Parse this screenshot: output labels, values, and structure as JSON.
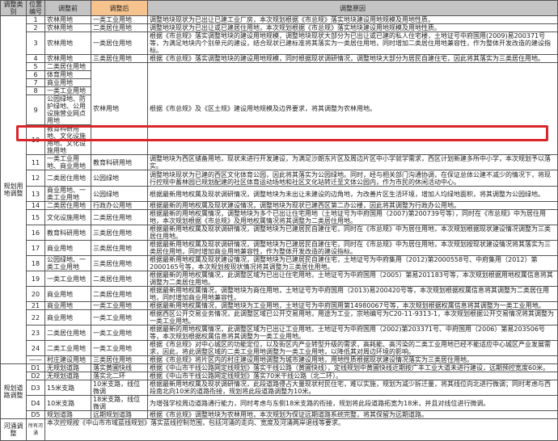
{
  "header": {
    "category": "调整类别",
    "no": "位置编号",
    "before": "调整前",
    "after": "调整后",
    "reason": "调整原因"
  },
  "categories": [
    "规划用地调整",
    "规划道路调整",
    "河涌调整"
  ],
  "rows": [
    {
      "no": "1",
      "before": "农林用地",
      "after": "一类工业用地",
      "reason": "调整地块现状为已出让已建工业厂房，本次规划根据《市总规》落实地块建设用地规模及用地性质。"
    },
    {
      "no": "2",
      "before": "农林用地",
      "after": "二类居住用地",
      "reason": "调整地块现状为已出让或已建居住用地，本次规划根据《市总规》落实地块建设用地规模及用地性质。"
    },
    {
      "no": "3",
      "before": "农林用地",
      "after": "一类居住用地",
      "reason": "根据《市总规》落实调整地块的建设用地规模，调整地块现状大部分为已出让或已建的私人住宅楼，土地证号中府国用(2009)易200371号等，为满足地块内个别单元的建设，结合现状已建标准将其落实为一类居住用地，同时增加二类居住用地兼容性，作为整体开发改造的建设指标。"
    },
    {
      "no": "4",
      "before": "农林用地",
      "after": "三类居住用地",
      "reason": "根据《市总规》落实调整地块的建设用地规模，同时根据现状调研情况，调整地块大部分为居民自建住宅，因此将其落实为三类居住用地。"
    },
    {
      "no": "5",
      "before": "二类居住用地",
      "after": "农林用地",
      "reason": "根据《市总规》及《区土规》建设用地规模及边界要求，将其调整为农林用地。"
    },
    {
      "no": "6",
      "before": "体育用地"
    },
    {
      "no": "7",
      "before": "商业用地"
    },
    {
      "no": "8",
      "before": "一类工业用地"
    },
    {
      "no": "9",
      "before": "公园绿地、防护绿地、公用设施营业网点用地"
    },
    {
      "no": "10",
      "before": "教育科研用地、文化设施用地、文化设施用地"
    },
    {
      "no": "11",
      "before": "一类工业用地、商业用地",
      "after": "教育科研用地",
      "reason": "调整地块为西区储备用地，现状未进行开发建设，为满足沙朗东片区及周边片区中小学就学需求，西区计划新建多所中小学，本次规划予以落实。"
    },
    {
      "no": "12",
      "before": "二类居住用地",
      "after": "公园绿地",
      "reason": "调整地块现状为已建的西区文化体育公园，因此将其落实为公园绿地。同时，经与相关部门沟通协调，在保证总体公建不减少的情况下，将现行控规中蓄林园已规划配建的社区体育运动场地和社区文化站转迁至文体公园内，作为市民的休闲活动中心。"
    },
    {
      "no": "13",
      "before": "商业用地、一类工业用地",
      "after": "公园绿地",
      "reason": "根据最新用地权属及现状调研情况，调整地块为未出让未建设的边角地，为改善片区生活环境，增加人均绿地面积，将其调整为公园绿地。"
    },
    {
      "no": "14",
      "before": "二类居住用地",
      "after": "行政办公用地",
      "reason": "根据最新的用地权属及现状建设情况，调整地块为现状已建西区第二办公楼，因此将其调整为行政办公用地。"
    },
    {
      "no": "15",
      "before": "文化设施用地",
      "after": "二类居住用地",
      "reason": "根据最新的用地权属情况，调整地块为多个已出让住宅用地（土地证号为中府国用（2007)第200739号等），同时在《市总规》中为居住用地，本次规划根据《市总规》及用地权属情况将其调整为二类居住用地。"
    },
    {
      "no": "16",
      "before": "教育科研用地",
      "after": "三类居住用地",
      "reason": "根据最新用地权属及现状调研情况，调整地块为已建居民自建住宅，同时在《市总规》中为居住用地，本次规划根据现状建设情况调整为三类居住用地。"
    },
    {
      "no": "17",
      "before": "商业用地",
      "after": "三类居住用地",
      "reason": "根据最新用地权属及现状调研情况，调整地块为已建居民自建住宅，同时在《市总规》中为居住用地，本次规划按现状建设情况将其落实为三类居住用地，同时增加商业用地兼容性，作为整体开发改造的建设指标。"
    },
    {
      "no": "18",
      "before": "公园绿地、一类工业用地",
      "after": "三类居住用地",
      "reason": "根据最新用地权属及现状建设情况，调整地块为已建居民自建住宅，土地证号为中府集用（2012)第2000558号、中府集用（2012）第2000165号等，本次规划按现状情况将其调整为三类居住用地。"
    },
    {
      "no": "19",
      "before": "一类工业用地",
      "after": "二类居住用地",
      "reason": "根据最新的用地权属情况，此调整区域为已出让住宅用地，土地证号为中府国用（2005）第易201183号等，本次规划根据用地权属信息将其调整为二类居住用地。"
    },
    {
      "no": "20",
      "before": "商业用地",
      "after": "二类居住用地",
      "reason": "根据最新用地权属情况，调整地块为商住用地，土地证号为中府国用（2013)易200420号等，本次规划根据权属信息将其调整为二类居住用地，同时增加商业用地兼容性。"
    },
    {
      "no": "21",
      "before": "商业用地",
      "after": "一类工业用地",
      "reason": "根据最新用地权属情况，调整地块为工业用地，土地证号为中府国用第14980067号等，本次规划根据权属信息将其调整为一类工业用地。"
    },
    {
      "no": "22",
      "before": "商业用地",
      "after": "一类工业用地",
      "reason": "根据西区公开交易业务情况，此调整区域已公开交易用地，用途为工业，宗地编号为C20-11-9313-1，本次规划根据公开交易情况将其调整为一类工业用地。"
    },
    {
      "no": "23",
      "before": "二类居住用地",
      "after": "一类工业用地",
      "reason": "根据最新的用地权属情况，此调整区域为已出让工业用地，土地证号为中府国用（2002)第203371号、中府国用（2006）第易203506号等，本次规划根据权属信息将其调整为一类工业用地。"
    },
    {
      "no": "24",
      "before": "二类工业用地",
      "after": "一类工业用地",
      "reason": "根据《市总规》对中心城区的功能定位，以及街区内产业转型升级的需求，高耗能、高污染的二类工业用地已经不能适应中心城区产业发展需求，因此，将此调整区域的二类工业用地调整为一类工业用地，以降低其对周边环境的影响。"
    },
    {
      "no": "——",
      "before": "村庄建设用地",
      "after": "三类居住用地",
      "reason": "根据《市总规》将片区内的村庄建设用地调整为城市建设用地，用地性质根据现状建设情况落实为三类居住用地。"
    },
    {
      "no": "D1",
      "before": "无规划道路",
      "after": "落实黄圃快线",
      "reason": "根据《中山市干线公路网定线规划》落实干线公路（黄圃快线），定线规划中黄圃快线近期按广丰工业大道未进行建设，远期预控宽度60米。"
    },
    {
      "no": "D2",
      "before": "无规划道路",
      "after": "落实北二环",
      "reason": "根据《中山市干线公路网定线规划》落实70米干线公路（北二环）。"
    },
    {
      "no": "D3",
      "before": "15米支路",
      "after": "10米支路，线位微调",
      "reason": "根据最新用地权属及现状调研情况，此段道路侵占大量现状村民住宅，难以实施，规划为减少拆迁量，将其线位向北进行微调；同时考虑与西段南北向10米的道路衔接，规划将此段道路调整为10米。"
    },
    {
      "no": "D4",
      "before": "10米支路",
      "after": "18米支路，线位微调",
      "reason": "为增强学校周边道路通行能力，同时考虑与东侧18米支路的衔接，规划将此段道路拓宽为18米，并且对线位进行微调。"
    },
    {
      "no": "D5",
      "before": "规划道路",
      "after": "远期规划道路",
      "reason": "根据《市总规》调整地块为农林用地，本次规划为保证远期道路系统完整，将其保留为远期道路。"
    }
  ],
  "river": {
    "no": "所有河涌",
    "reason": "本次控规按《中山市市域蓝线规划》落实蓝线控制范围，包括河涌的走向、宽度及河涌两岸退线等要求。"
  },
  "highlight_color": "#d9262b"
}
